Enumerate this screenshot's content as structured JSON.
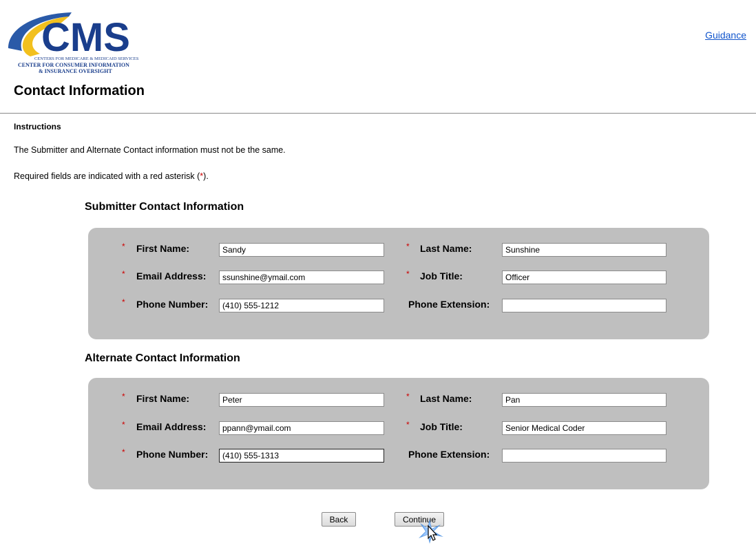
{
  "logo": {
    "main_text": "CMS",
    "line1": "CENTERS FOR MEDICARE & MEDICAID SERVICES",
    "line2": "CENTER FOR CONSUMER INFORMATION",
    "line3": "& INSURANCE OVERSIGHT"
  },
  "header": {
    "guidance_link": "Guidance"
  },
  "page": {
    "title": "Contact Information"
  },
  "instructions": {
    "heading": "Instructions",
    "line1": "The Submitter and Alternate Contact information must not be the same.",
    "line2_prefix": "Required fields are indicated with a red asterisk (",
    "line2_asterisk": "*",
    "line2_suffix": ")."
  },
  "required_marker": "*",
  "submitter": {
    "title": "Submitter Contact Information",
    "first_name_label": "First Name:",
    "first_name_value": "Sandy",
    "last_name_label": "Last Name:",
    "last_name_value": "Sunshine",
    "email_label": "Email Address:",
    "email_value": "ssunshine@ymail.com",
    "job_title_label": "Job Title:",
    "job_title_value": "Officer",
    "phone_label": "Phone Number:",
    "phone_value": "(410) 555-1212",
    "extension_label": "Phone Extension:",
    "extension_value": ""
  },
  "alternate": {
    "title": "Alternate Contact Information",
    "first_name_label": "First Name:",
    "first_name_value": "Peter",
    "last_name_label": "Last Name:",
    "last_name_value": "Pan",
    "email_label": "Email Address:",
    "email_value": "ppann@ymail.com",
    "job_title_label": "Job Title:",
    "job_title_value": "Senior Medical Coder",
    "phone_label": "Phone Number:",
    "phone_value": "(410) 555-1313",
    "extension_label": "Phone Extension:",
    "extension_value": ""
  },
  "buttons": {
    "back": "Back",
    "continue": "Continue"
  },
  "colors": {
    "panel": "#bfbfbf",
    "required": "#cc0000",
    "link": "#1155cc",
    "logo_blue": "#1a3e8c",
    "logo_swoosh": "#f2c01e"
  }
}
